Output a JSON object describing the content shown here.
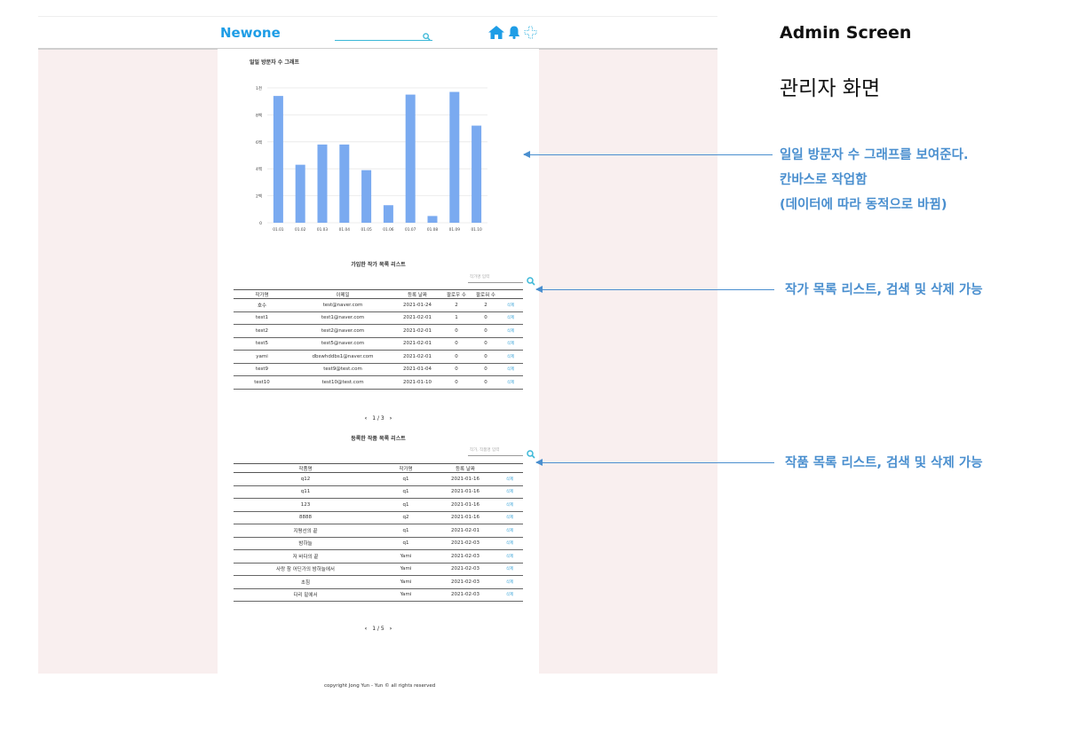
{
  "header": {
    "logo": "Newone"
  },
  "side": {
    "title": "Admin Screen",
    "subtitle": "관리자 화면",
    "notes": [
      [
        "일일 방문자 수 그래프를 보여준다.",
        "칸바스로 작업함",
        "(데이터에 따라 동적으로 바뀜)"
      ],
      [
        "작가 목록 리스트, 검색 및 삭제 가능"
      ],
      [
        "작품 목록 리스트, 검색 및 삭제 가능"
      ]
    ]
  },
  "chart_data": {
    "type": "bar",
    "title": "일일 방문자 수 그래프",
    "categories": [
      "01.01",
      "01.02",
      "01.03",
      "01.04",
      "01.05",
      "01.06",
      "01.07",
      "01.08",
      "01.09",
      "01.10"
    ],
    "values": [
      9.4,
      4.3,
      5.8,
      5.8,
      3.9,
      1.3,
      9.5,
      0.5,
      9.7,
      7.2
    ],
    "yticks": [
      "0",
      "2백",
      "4백",
      "6백",
      "8백",
      "1천"
    ],
    "ylim": [
      0,
      10
    ],
    "grid": true,
    "color": "#7aaaf0"
  },
  "writers": {
    "title": "가입한 작가 목록 리스트",
    "search_placeholder": "작가명 입력",
    "columns": [
      "작가명",
      "이메일",
      "등록 날짜",
      "팔로우 수",
      "팔로워 수",
      ""
    ],
    "rows": [
      [
        "호수",
        "test@naver.com",
        "2021-01-24",
        "2",
        "2",
        "삭제"
      ],
      [
        "test1",
        "test1@naver.com",
        "2021-02-01",
        "1",
        "0",
        "삭제"
      ],
      [
        "test2",
        "test2@naver.com",
        "2021-02-01",
        "0",
        "0",
        "삭제"
      ],
      [
        "test5",
        "test5@naver.com",
        "2021-02-01",
        "0",
        "0",
        "삭제"
      ],
      [
        "yami",
        "dbswhddbs1@naver.com",
        "2021-02-01",
        "0",
        "0",
        "삭제"
      ],
      [
        "test9",
        "test9@test.com",
        "2021-01-04",
        "0",
        "0",
        "삭제"
      ],
      [
        "test10",
        "test10@test.com",
        "2021-01-10",
        "0",
        "0",
        "삭제"
      ]
    ],
    "pager": "1 / 3"
  },
  "works": {
    "title": "등록한 작품 목록 리스트",
    "search_placeholder": "작가, 작품명 입력",
    "columns": [
      "작품명",
      "작가명",
      "등록 날짜",
      ""
    ],
    "rows": [
      [
        "q12",
        "q1",
        "2021-01-16",
        "삭제"
      ],
      [
        "q11",
        "q1",
        "2021-01-16",
        "삭제"
      ],
      [
        "123",
        "q1",
        "2021-01-16",
        "삭제"
      ],
      [
        "8888",
        "q2",
        "2021-01-16",
        "삭제"
      ],
      [
        "지평선의 끝",
        "q1",
        "2021-02-01",
        "삭제"
      ],
      [
        "밤하늘",
        "q1",
        "2021-02-03",
        "삭제"
      ],
      [
        "저 바다의 끝",
        "Yami",
        "2021-02-03",
        "삭제"
      ],
      [
        "사랑 참 어딘가의 밤하늘에서",
        "Yami",
        "2021-02-03",
        "삭제"
      ],
      [
        "초침",
        "Yami",
        "2021-02-03",
        "삭제"
      ],
      [
        "다리 밑에서",
        "Yami",
        "2021-02-03",
        "삭제"
      ]
    ],
    "pager": "1 / 5"
  },
  "footer": "copyright Jong Yun - Yun © all rights reserved"
}
